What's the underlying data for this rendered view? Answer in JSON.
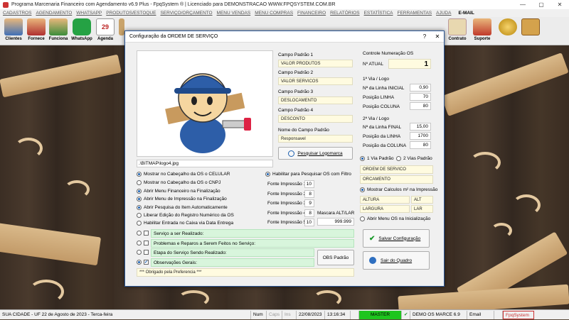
{
  "window": {
    "title": "Programa Marcenaria Financeiro com Agendamento v6.9 Plus - FpqSystem ® | Licenciado para  DEMONSTRACAO WWW.FPQSYSTEM.COM.BR",
    "minimize": "—",
    "maximize": "▢",
    "close": "✕"
  },
  "menu": [
    "CADASTROS",
    "AGENDAMENTO",
    "WHATSAPP",
    "PRODUTOS/ESTOQUE",
    "SERVIÇO/ORÇAMENTO",
    "MENU VENDAS",
    "MENU COMPRAS",
    "FINANCEIRO",
    "RELATÓRIOS",
    "ESTATÍSTICA",
    "FERRAMENTAS",
    "AJUDA"
  ],
  "menu_email": "E-MAIL",
  "toolbar": {
    "clientes": "Clientes",
    "fornece": "Fornece",
    "funciona": "Funciona",
    "whatsapp": "WhatsApp",
    "agenda": "Agenda",
    "calendar_day": "29",
    "contrato": "Contrato",
    "suporte": "Suporte"
  },
  "dialog": {
    "title": "Configuração da ORDEM DE SERVIÇO",
    "help": "?",
    "close": "✕",
    "logo_path": ".\\BITMAP\\logo4.jpg",
    "campo1_label": "Campo Padrão 1",
    "campo1_value": "VALOR PRODUTOS",
    "campo2_label": "Campo Padrão 2",
    "campo2_value": "VALOR SERVICOS",
    "campo3_label": "Campo Padrão 3",
    "campo3_value": "DESLOCAMENTO",
    "campo4_label": "Campo Padrão 4",
    "campo4_value": "DESCONTO",
    "nome_label": "Nome do Campo Padrão",
    "nome_value": "Responsavel",
    "pesquisar_logo": "Pesquisar Logomarca",
    "controle_label": "Controle Numeração OS",
    "n_atual_label": "Nº ATUAL",
    "n_atual_value": "1",
    "via1_label": "1ª Via / Logo",
    "linha_inicial_label": "Nª da Linha INICIAL",
    "linha_inicial_value": "0,90",
    "posicao_linha_label": "Posição LINHA",
    "posicao_linha_value": "70",
    "posicao_coluna_label": "Posição COLUNA",
    "posicao_coluna_value": "80",
    "via2_label": "2ª Via / Logo",
    "linha_final_label": "Nª da Linha FINAL",
    "linha_final_value": "15,00",
    "posicao_da_linha_label": "Posição da LINHA",
    "posicao_da_linha_value": "1700",
    "posicao_da_coluna_label": "Posição da COLUNA",
    "posicao_da_coluna_value": "80",
    "via_padrao1": "1 Via Padrão",
    "via_padrao2": "2 Vias Padrão",
    "ordem_servico": "ORDEM DE SERVICO",
    "orcamento": "ORCAMENTO",
    "mostrar_calculos": "Mostrar Calculos m² na Impressão",
    "altura": "ALTURA",
    "alt": "ALT",
    "largura": "LARGURA",
    "lar": "LAR",
    "abrir_menu_os": "Abrir Menu OS na Inicialização",
    "salvar": "Salvar Configuração",
    "sair": "Sair do Quadro",
    "opts": [
      "Mostrar no Cabeçalho da OS o CELULAR",
      "Mostrar no Cabeçalho da OS o CNPJ",
      "Abrir Menu Financeiro na Finalização",
      "Abrir Menu de Impressão na Finalização",
      "Abrir Pesquisa do Item Automaticamente",
      "Liberar Edição do Registro Numérico da OS",
      "Habilitar Entrada no Caixa via Data Entrega"
    ],
    "habilitar_pesquisar": "Habilitar para Pesquisar OS com Filtro",
    "fontes": [
      {
        "label": "Fonte Impressão 1",
        "value": "10"
      },
      {
        "label": "Fonte Impressão 2",
        "value": "8"
      },
      {
        "label": "Fonte Impressão 3",
        "value": "9"
      },
      {
        "label": "Fonte Impressão 4",
        "value": "8"
      },
      {
        "label": "Fonte Impressão 5",
        "value": "10"
      }
    ],
    "mascara_label": "Mascara ALT/LAR",
    "mascara_value": "999.999",
    "servico_realizado": "Serviço a ser Realizado:",
    "problemas": "Problemas e Reparos a Serem Feitos no Serviço:",
    "etapa": "Etapa do Serviço Sendo Realizado:",
    "observacoes": "Observações Gerais:",
    "obs_padrao": "OBS Padrão",
    "obrigado": "*** Obrigado pela Preferencia ***"
  },
  "status": {
    "city": "SUA CIDADE - UF 22 de Agosto de 2023 - Terca-feira",
    "num": "Num",
    "caps": "Caps",
    "ins": "Ins",
    "date": "22/08/2023",
    "time": "13:16:34",
    "master": "MASTER",
    "demo": "DEMO OS MARCE 6.9",
    "email": "Email",
    "fpq": "FpqSystem"
  }
}
